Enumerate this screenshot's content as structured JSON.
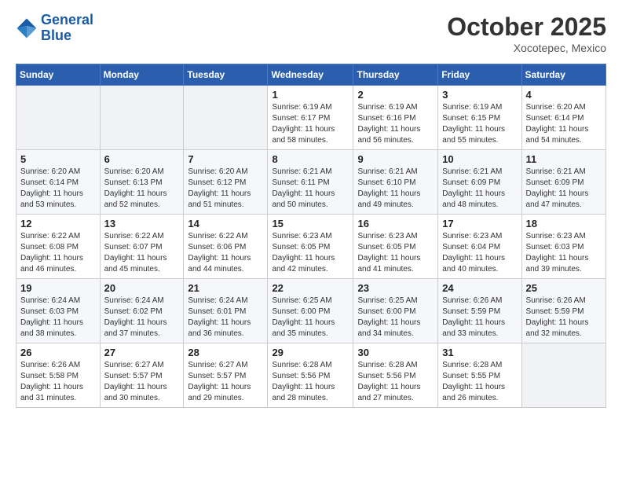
{
  "header": {
    "logo_line1": "General",
    "logo_line2": "Blue",
    "month": "October 2025",
    "location": "Xocotepec, Mexico"
  },
  "weekdays": [
    "Sunday",
    "Monday",
    "Tuesday",
    "Wednesday",
    "Thursday",
    "Friday",
    "Saturday"
  ],
  "weeks": [
    [
      {
        "day": "",
        "info": ""
      },
      {
        "day": "",
        "info": ""
      },
      {
        "day": "",
        "info": ""
      },
      {
        "day": "1",
        "info": "Sunrise: 6:19 AM\nSunset: 6:17 PM\nDaylight: 11 hours\nand 58 minutes."
      },
      {
        "day": "2",
        "info": "Sunrise: 6:19 AM\nSunset: 6:16 PM\nDaylight: 11 hours\nand 56 minutes."
      },
      {
        "day": "3",
        "info": "Sunrise: 6:19 AM\nSunset: 6:15 PM\nDaylight: 11 hours\nand 55 minutes."
      },
      {
        "day": "4",
        "info": "Sunrise: 6:20 AM\nSunset: 6:14 PM\nDaylight: 11 hours\nand 54 minutes."
      }
    ],
    [
      {
        "day": "5",
        "info": "Sunrise: 6:20 AM\nSunset: 6:14 PM\nDaylight: 11 hours\nand 53 minutes."
      },
      {
        "day": "6",
        "info": "Sunrise: 6:20 AM\nSunset: 6:13 PM\nDaylight: 11 hours\nand 52 minutes."
      },
      {
        "day": "7",
        "info": "Sunrise: 6:20 AM\nSunset: 6:12 PM\nDaylight: 11 hours\nand 51 minutes."
      },
      {
        "day": "8",
        "info": "Sunrise: 6:21 AM\nSunset: 6:11 PM\nDaylight: 11 hours\nand 50 minutes."
      },
      {
        "day": "9",
        "info": "Sunrise: 6:21 AM\nSunset: 6:10 PM\nDaylight: 11 hours\nand 49 minutes."
      },
      {
        "day": "10",
        "info": "Sunrise: 6:21 AM\nSunset: 6:09 PM\nDaylight: 11 hours\nand 48 minutes."
      },
      {
        "day": "11",
        "info": "Sunrise: 6:21 AM\nSunset: 6:09 PM\nDaylight: 11 hours\nand 47 minutes."
      }
    ],
    [
      {
        "day": "12",
        "info": "Sunrise: 6:22 AM\nSunset: 6:08 PM\nDaylight: 11 hours\nand 46 minutes."
      },
      {
        "day": "13",
        "info": "Sunrise: 6:22 AM\nSunset: 6:07 PM\nDaylight: 11 hours\nand 45 minutes."
      },
      {
        "day": "14",
        "info": "Sunrise: 6:22 AM\nSunset: 6:06 PM\nDaylight: 11 hours\nand 44 minutes."
      },
      {
        "day": "15",
        "info": "Sunrise: 6:23 AM\nSunset: 6:05 PM\nDaylight: 11 hours\nand 42 minutes."
      },
      {
        "day": "16",
        "info": "Sunrise: 6:23 AM\nSunset: 6:05 PM\nDaylight: 11 hours\nand 41 minutes."
      },
      {
        "day": "17",
        "info": "Sunrise: 6:23 AM\nSunset: 6:04 PM\nDaylight: 11 hours\nand 40 minutes."
      },
      {
        "day": "18",
        "info": "Sunrise: 6:23 AM\nSunset: 6:03 PM\nDaylight: 11 hours\nand 39 minutes."
      }
    ],
    [
      {
        "day": "19",
        "info": "Sunrise: 6:24 AM\nSunset: 6:03 PM\nDaylight: 11 hours\nand 38 minutes."
      },
      {
        "day": "20",
        "info": "Sunrise: 6:24 AM\nSunset: 6:02 PM\nDaylight: 11 hours\nand 37 minutes."
      },
      {
        "day": "21",
        "info": "Sunrise: 6:24 AM\nSunset: 6:01 PM\nDaylight: 11 hours\nand 36 minutes."
      },
      {
        "day": "22",
        "info": "Sunrise: 6:25 AM\nSunset: 6:00 PM\nDaylight: 11 hours\nand 35 minutes."
      },
      {
        "day": "23",
        "info": "Sunrise: 6:25 AM\nSunset: 6:00 PM\nDaylight: 11 hours\nand 34 minutes."
      },
      {
        "day": "24",
        "info": "Sunrise: 6:26 AM\nSunset: 5:59 PM\nDaylight: 11 hours\nand 33 minutes."
      },
      {
        "day": "25",
        "info": "Sunrise: 6:26 AM\nSunset: 5:59 PM\nDaylight: 11 hours\nand 32 minutes."
      }
    ],
    [
      {
        "day": "26",
        "info": "Sunrise: 6:26 AM\nSunset: 5:58 PM\nDaylight: 11 hours\nand 31 minutes."
      },
      {
        "day": "27",
        "info": "Sunrise: 6:27 AM\nSunset: 5:57 PM\nDaylight: 11 hours\nand 30 minutes."
      },
      {
        "day": "28",
        "info": "Sunrise: 6:27 AM\nSunset: 5:57 PM\nDaylight: 11 hours\nand 29 minutes."
      },
      {
        "day": "29",
        "info": "Sunrise: 6:28 AM\nSunset: 5:56 PM\nDaylight: 11 hours\nand 28 minutes."
      },
      {
        "day": "30",
        "info": "Sunrise: 6:28 AM\nSunset: 5:56 PM\nDaylight: 11 hours\nand 27 minutes."
      },
      {
        "day": "31",
        "info": "Sunrise: 6:28 AM\nSunset: 5:55 PM\nDaylight: 11 hours\nand 26 minutes."
      },
      {
        "day": "",
        "info": ""
      }
    ]
  ]
}
